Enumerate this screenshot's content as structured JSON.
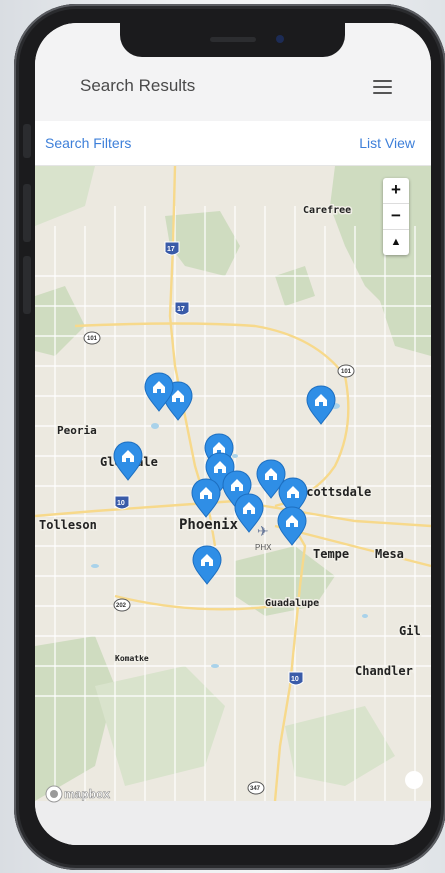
{
  "header": {
    "title": "Search Results"
  },
  "subbar": {
    "filters_label": "Search Filters",
    "list_view_label": "List View"
  },
  "map": {
    "zoom_in": "+",
    "zoom_out": "−",
    "compass": "▲",
    "attribution": "mapbox",
    "cities": [
      "Carefree",
      "Peoria",
      "Glendale",
      "Scottsdale",
      "Tolleson",
      "Phoenix",
      "Tempe",
      "Mesa",
      "Guadalupe",
      "Gil",
      "Chandler",
      "Komatke"
    ],
    "airport_code": "PHX",
    "highway_badges": [
      "17",
      "17",
      "101",
      "101",
      "10",
      "202",
      "10",
      "347"
    ],
    "pin_count": 15
  },
  "colors": {
    "accent": "#3d7fd9",
    "pin": "#2f8ee6",
    "map_base": "#ece9e0"
  }
}
